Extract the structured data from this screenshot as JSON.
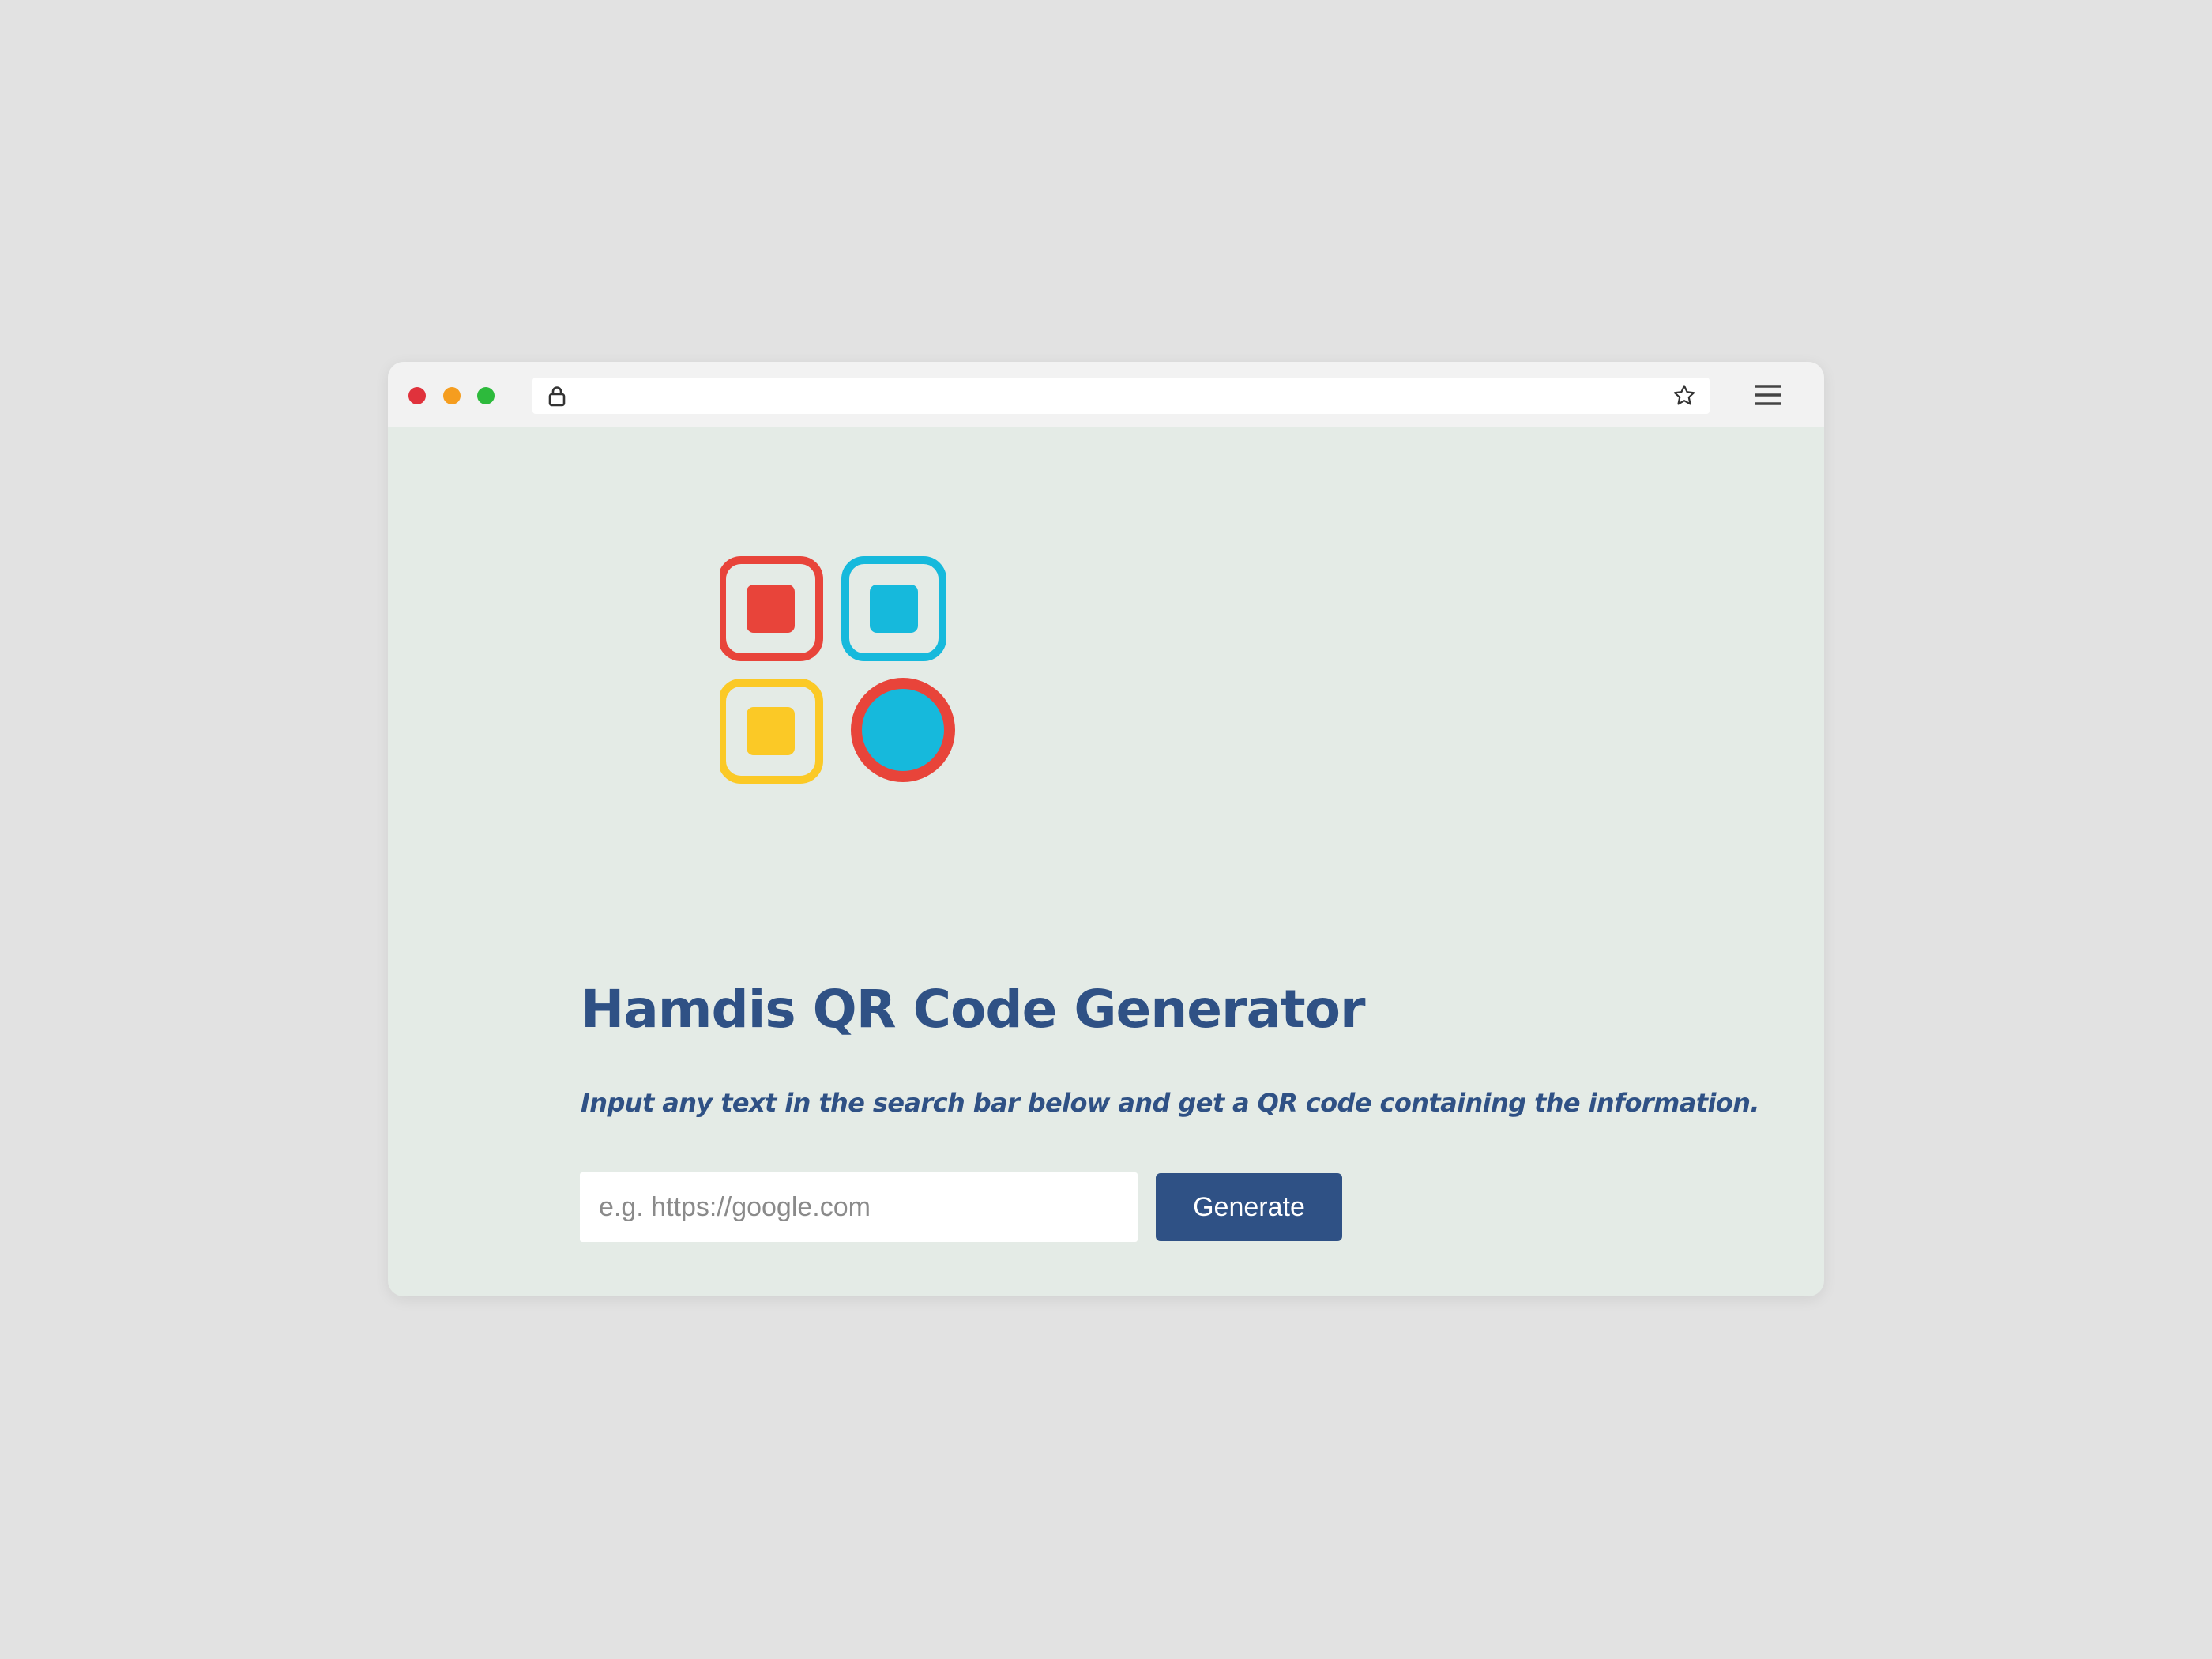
{
  "browser": {
    "window_controls": [
      "close",
      "minimize",
      "maximize"
    ],
    "address_bar": {
      "url": "",
      "lock_icon": "lock-icon",
      "bookmark_icon": "star-icon"
    },
    "menu_icon": "hamburger-menu-icon"
  },
  "page": {
    "logo_icon": "qr-code-logo-icon",
    "title": "Hamdis QR Code Generator",
    "subtitle": "Input any text in the search bar below and get a QR code containing the information.",
    "input": {
      "value": "",
      "placeholder": "e.g. https://google.com"
    },
    "generate_button_label": "Generate"
  },
  "colors": {
    "page_background": "#e4ebe6",
    "primary": "#2f5185",
    "logo_red": "#e8443a",
    "logo_blue": "#16b9dc",
    "logo_yellow": "#fbc926"
  }
}
